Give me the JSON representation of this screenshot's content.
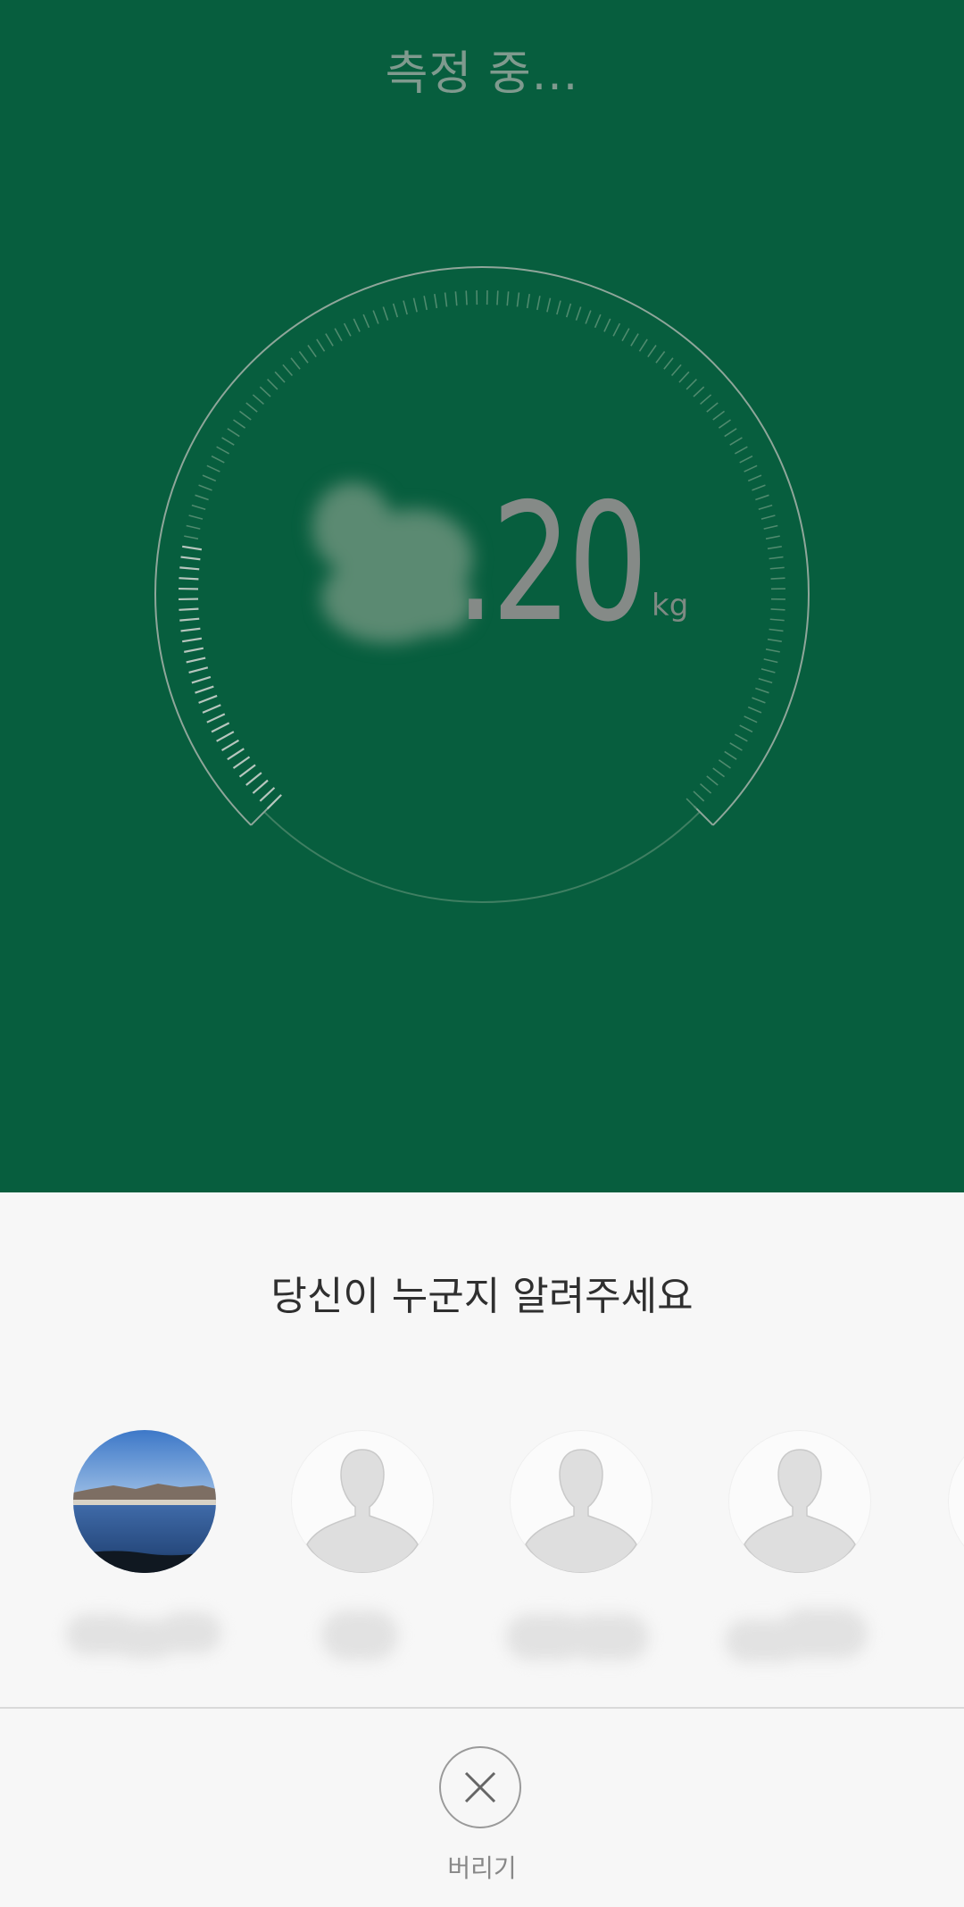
{
  "header": {
    "status": "측정 중..."
  },
  "measurement": {
    "value_visible": ".20",
    "unit": "kg",
    "gauge_progress_fraction": 0.2
  },
  "panel": {
    "title": "당신이 누군지 알려주세요"
  },
  "users": [
    {
      "avatar": "landscape-photo",
      "name": ""
    },
    {
      "avatar": "default-person-icon",
      "name": ""
    },
    {
      "avatar": "default-person-icon",
      "name": ""
    },
    {
      "avatar": "default-person-icon",
      "name": ""
    }
  ],
  "footer": {
    "close_label": "버리기",
    "close_icon": "close-icon"
  },
  "colors": {
    "top_background": "#075e3e",
    "panel_background": "#f7f7f7",
    "gauge_stroke": "#8fa69a"
  }
}
